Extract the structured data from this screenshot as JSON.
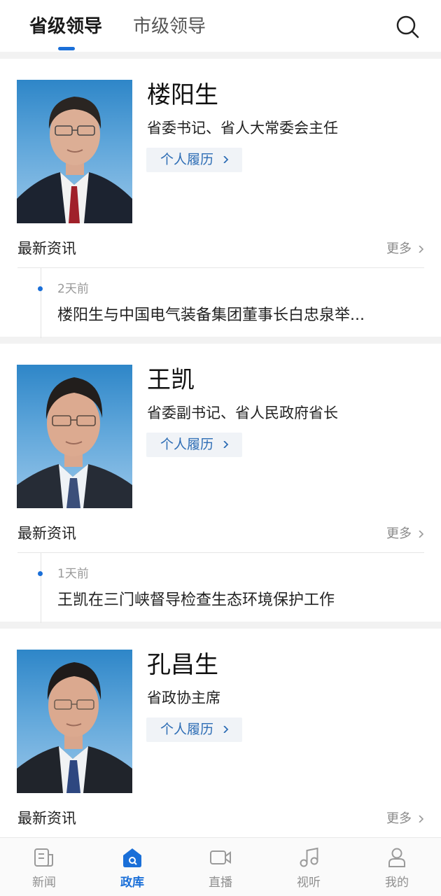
{
  "tabs": {
    "active": "省级领导",
    "inactive": "市级领导"
  },
  "leaders": [
    {
      "name": "楼阳生",
      "title": "省委书记、省人大常委会主任",
      "resume": "个人履历",
      "section": "最新资讯",
      "more": "更多",
      "news_time": "2天前",
      "news_title": "楼阳生与中国电气装备集团董事长白忠泉举..."
    },
    {
      "name": "王凯",
      "title": "省委副书记、省人民政府省长",
      "resume": "个人履历",
      "section": "最新资讯",
      "more": "更多",
      "news_time": "1天前",
      "news_title": "王凯在三门峡督导检查生态环境保护工作"
    },
    {
      "name": "孔昌生",
      "title": "省政协主席",
      "resume": "个人履历",
      "section": "最新资讯",
      "more": "更多"
    }
  ],
  "nav": [
    {
      "label": "新闻",
      "icon": "news-icon"
    },
    {
      "label": "政库",
      "icon": "library-icon"
    },
    {
      "label": "直播",
      "icon": "live-video-icon"
    },
    {
      "label": "视听",
      "icon": "music-note-icon"
    },
    {
      "label": "我的",
      "icon": "user-icon"
    }
  ],
  "colors": {
    "accent": "#1a6fd8",
    "link": "#2d6db5"
  }
}
